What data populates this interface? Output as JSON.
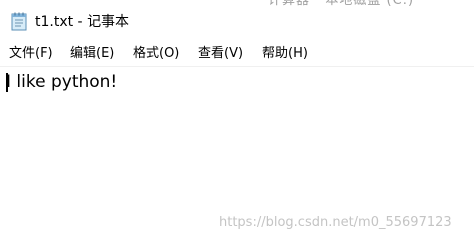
{
  "window": {
    "title": "t1.txt - 记事本",
    "behind_title_fragment": "计算器 · 本地磁盘 (C:)",
    "accent_color": "#000000"
  },
  "app_icon": {
    "name": "notepad-icon"
  },
  "menubar": {
    "items": [
      {
        "label": "文件(F)"
      },
      {
        "label": "编辑(E)"
      },
      {
        "label": "格式(O)"
      },
      {
        "label": "查看(V)"
      },
      {
        "label": "帮助(H)"
      }
    ]
  },
  "editor": {
    "content": "I like python!"
  },
  "watermark": {
    "text": "https://blog.csdn.net/m0_55697123"
  }
}
